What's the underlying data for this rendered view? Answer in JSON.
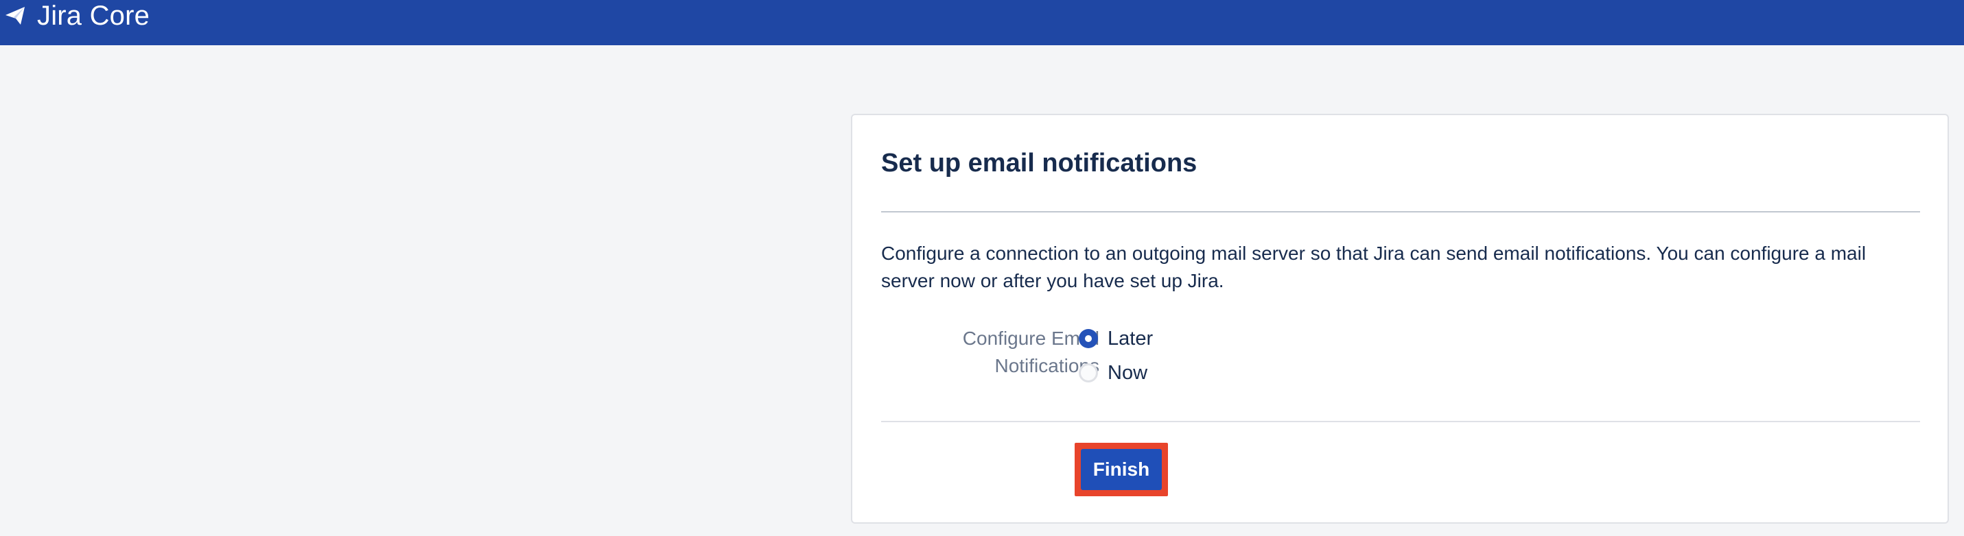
{
  "header": {
    "product_name": "Jira Core",
    "logo_icon": "jira-core-logo-icon",
    "background_color": "#1f47a4"
  },
  "card": {
    "title": "Set up email notifications",
    "description": "Configure a connection to an outgoing mail server so that Jira can send email notifications. You can configure a mail server now or after you have set up Jira.",
    "field": {
      "label": "Configure Email Notifications",
      "options": [
        {
          "label": "Later",
          "checked": true
        },
        {
          "label": "Now",
          "checked": false
        }
      ]
    },
    "finish_label": "Finish",
    "highlight_color": "#e8442b",
    "button_color": "#1f4fb8"
  }
}
